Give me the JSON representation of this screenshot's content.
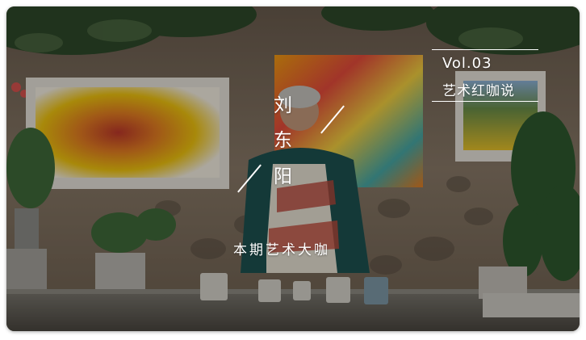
{
  "banner": {
    "vol": "Vol.03",
    "column": "艺术红咖说",
    "artist_name": [
      "刘",
      "东",
      "阳"
    ],
    "caption": "本期艺术大咖"
  },
  "colors": {
    "text": "#ffffff",
    "overlay": "rgba(0,0,0,0.30)"
  },
  "icons": [
    "slash-decoration-icon"
  ]
}
